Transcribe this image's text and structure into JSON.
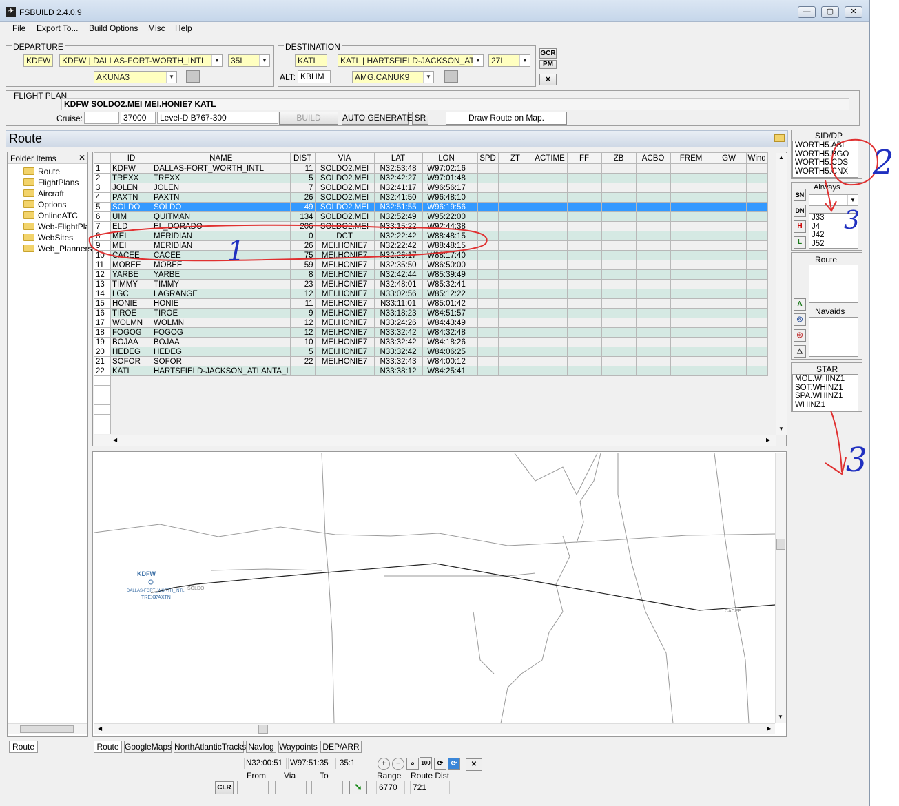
{
  "window": {
    "title": "FSBUILD 2.4.0.9"
  },
  "menu": [
    "File",
    "Export To...",
    "Build Options",
    "Misc",
    "Help"
  ],
  "departure": {
    "label": "DEPARTURE",
    "icao": "KDFW",
    "airport": "KDFW | DALLAS-FORT-WORTH_INTL",
    "runway": "35L",
    "sid": "AKUNA3"
  },
  "destination": {
    "label": "DESTINATION",
    "icao": "KATL",
    "airport": "KATL | HARTSFIELD-JACKSON_ATLAN",
    "runway": "27L",
    "alt_label": "ALT:",
    "alt": "KBHM",
    "star": "AMG.CANUK9"
  },
  "side_buttons": {
    "gcr": "GCR",
    "pm": "PM"
  },
  "flightplan": {
    "label": "FLIGHT PLAN",
    "route": "KDFW SOLDO2.MEI MEI.HONIE7 KATL",
    "cruise_label": "Cruise:",
    "cruise_alt": "37000",
    "aircraft": "Level-D B767-300",
    "build": "BUILD",
    "auto": "AUTO GENERATE",
    "sr": "SR",
    "draw": "Draw Route on Map."
  },
  "section": {
    "title": "Route"
  },
  "folder": {
    "header": "Folder Items",
    "items": [
      "Route",
      "FlightPlans",
      "Aircraft",
      "Options",
      "OnlineATC",
      "Web-FlightPlans",
      "WebSites",
      "Web_Planners"
    ],
    "bottom_tab": "Route"
  },
  "grid": {
    "columns": [
      "ID",
      "NAME",
      "DIST",
      "VIA",
      "LAT",
      "LON",
      "SPD",
      "ZT",
      "ACTIME",
      "FF",
      "ZB",
      "ACBO",
      "FREM",
      "GW",
      "Wind"
    ],
    "rows": [
      [
        "1",
        "KDFW",
        "DALLAS-FORT_WORTH_INTL",
        "11",
        "SOLDO2.MEI",
        "N32:53:48",
        "W97:02:16"
      ],
      [
        "2",
        "TREXX",
        "TREXX",
        "5",
        "SOLDO2.MEI",
        "N32:42:27",
        "W97:01:48"
      ],
      [
        "3",
        "JOLEN",
        "JOLEN",
        "7",
        "SOLDO2.MEI",
        "N32:41:17",
        "W96:56:17"
      ],
      [
        "4",
        "PAXTN",
        "PAXTN",
        "26",
        "SOLDO2.MEI",
        "N32:41:50",
        "W96:48:10"
      ],
      [
        "5",
        "SOLDO",
        "SOLDO",
        "49",
        "SOLDO2.MEI",
        "N32:51:55",
        "W96:19:56"
      ],
      [
        "6",
        "UIM",
        "QUITMAN",
        "134",
        "SOLDO2.MEI",
        "N32:52:49",
        "W95:22:00"
      ],
      [
        "7",
        "ELD",
        "EL_DORADO",
        "206",
        "SOLDO2.MEI",
        "N33:15:22",
        "W92:44:38"
      ],
      [
        "8",
        "MEI",
        "MERIDIAN",
        "0",
        "DCT",
        "N32:22:42",
        "W88:48:15"
      ],
      [
        "9",
        "MEI",
        "MERIDIAN",
        "26",
        "MEI.HONIE7",
        "N32:22:42",
        "W88:48:15"
      ],
      [
        "10",
        "CACEE",
        "CACEE",
        "75",
        "MEI.HONIE7",
        "N32:26:17",
        "W88:17:40"
      ],
      [
        "11",
        "MOBEE",
        "MOBEE",
        "59",
        "MEI.HONIE7",
        "N32:35:50",
        "W86:50:00"
      ],
      [
        "12",
        "YARBE",
        "YARBE",
        "8",
        "MEI.HONIE7",
        "N32:42:44",
        "W85:39:49"
      ],
      [
        "13",
        "TIMMY",
        "TIMMY",
        "23",
        "MEI.HONIE7",
        "N32:48:01",
        "W85:32:41"
      ],
      [
        "14",
        "LGC",
        "LAGRANGE",
        "12",
        "MEI.HONIE7",
        "N33:02:56",
        "W85:12:22"
      ],
      [
        "15",
        "HONIE",
        "HONIE",
        "11",
        "MEI.HONIE7",
        "N33:11:01",
        "W85:01:42"
      ],
      [
        "16",
        "TIROE",
        "TIROE",
        "9",
        "MEI.HONIE7",
        "N33:18:23",
        "W84:51:57"
      ],
      [
        "17",
        "WOLMN",
        "WOLMN",
        "12",
        "MEI.HONIE7",
        "N33:24:26",
        "W84:43:49"
      ],
      [
        "18",
        "FOGOG",
        "FOGOG",
        "12",
        "MEI.HONIE7",
        "N33:32:42",
        "W84:32:48"
      ],
      [
        "19",
        "BOJAA",
        "BOJAA",
        "10",
        "MEI.HONIE7",
        "N33:32:42",
        "W84:18:26"
      ],
      [
        "20",
        "HEDEG",
        "HEDEG",
        "5",
        "MEI.HONIE7",
        "N33:32:42",
        "W84:06:25"
      ],
      [
        "21",
        "SOFOR",
        "SOFOR",
        "22",
        "MEI.HONIE7",
        "N33:32:43",
        "W84:00:12"
      ],
      [
        "22",
        "KATL",
        "HARTSFIELD-JACKSON_ATLANTA_I",
        "",
        "",
        "N33:38:12",
        "W84:25:41"
      ]
    ]
  },
  "right": {
    "sid_label": "SID/DP",
    "sids": [
      "WORTH5.ABI",
      "WORTH5.BGO",
      "WORTH5.CDS",
      "WORTH5.CNX"
    ],
    "airways_label": "Airways",
    "airways": [
      "J33",
      "J4",
      "J42",
      "J52"
    ],
    "btn_sn": "SN",
    "btn_dn": "DN",
    "btn_h": "H",
    "btn_l": "L",
    "btn_a": "A",
    "route_label": "Route",
    "navaids_label": "Navaids",
    "star_label": "STAR",
    "stars": [
      "MOL.WHINZ1",
      "SOT.WHINZ1",
      "SPA.WHINZ1",
      "WHINZ1"
    ]
  },
  "map": {
    "origin_label": "KDFW",
    "labels": [
      "KDFW",
      "DALLAS-FORT_WORTH_INTL",
      "TREXX",
      "PAXTN",
      "SOLDO",
      "CACEE"
    ]
  },
  "tabs": [
    "Route",
    "GoogleMaps",
    "NorthAtlanticTracks",
    "Navlog",
    "Waypoints",
    "DEP/ARR"
  ],
  "status": {
    "lat": "N32:00:51",
    "lon": "W97:51:35",
    "zoom": "35:1",
    "clr": "CLR",
    "from": "From",
    "via": "Via",
    "to": "To",
    "range_label": "Range",
    "range": "6770",
    "dist_label": "Route Dist",
    "dist": "721",
    "zoom_pct": "100"
  },
  "annotations": [
    "1",
    "2",
    "3",
    "3"
  ],
  "colors": {
    "selected": "#3399ff",
    "alt_row": "#d5e9e3",
    "field_yellow": "#ffffc0",
    "annotation_red": "#e03030",
    "annotation_blue": "#2030c0"
  }
}
